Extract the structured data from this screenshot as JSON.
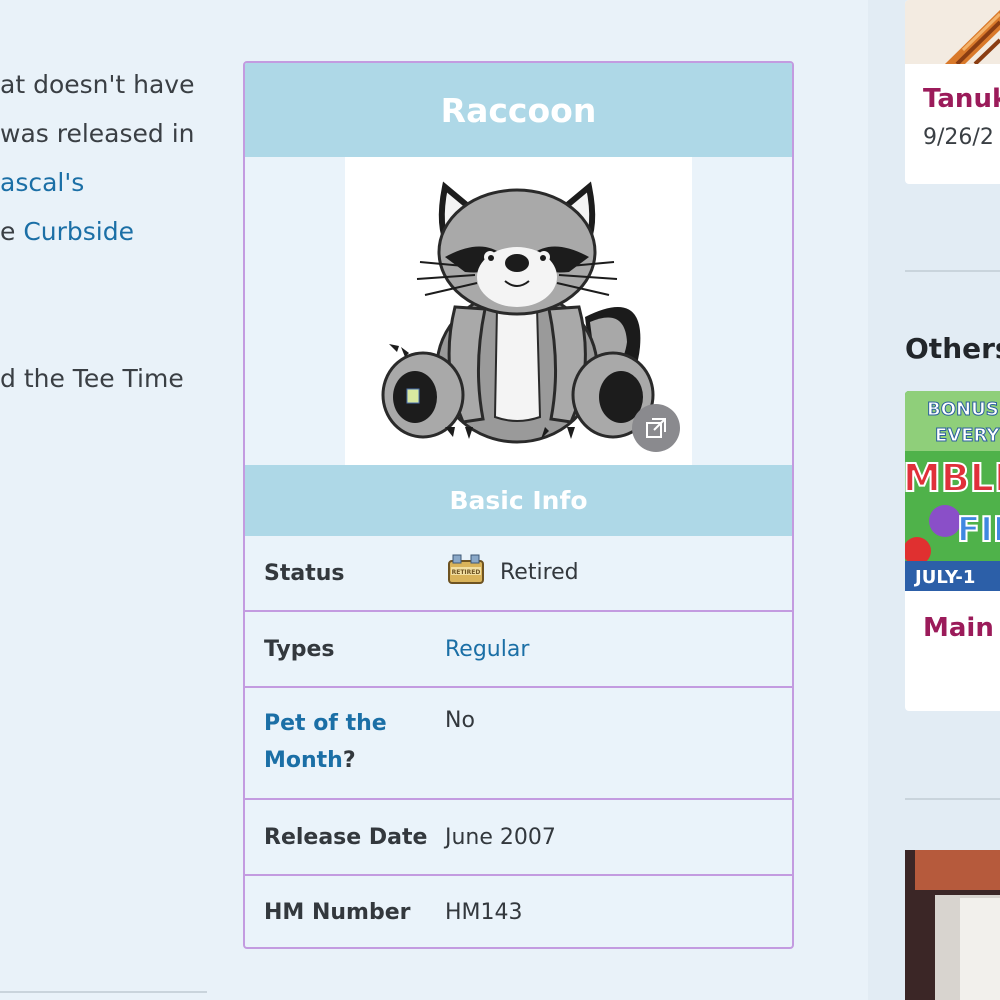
{
  "article": {
    "line1": "at doesn't have",
    "line2": "was released in",
    "line3_link": "ascal's",
    "line4_prefix": "e ",
    "line4_link": "Curbside",
    "line5": "d the Tee Time"
  },
  "infobox": {
    "title": "Raccoon",
    "section_title": "Basic Info",
    "rows": [
      {
        "label": "Status",
        "value": "Retired"
      },
      {
        "label": "Types",
        "value": "Regular"
      },
      {
        "label_link_1": "Pet of the",
        "label_link_2": "Month",
        "label_suffix": "?",
        "value": "No"
      },
      {
        "label": "Release Date",
        "value": "June 2007"
      },
      {
        "label": "HM Number",
        "value": "HM143"
      }
    ],
    "badge_text": "RETIRED"
  },
  "sidebar": {
    "card1": {
      "title": "Tanuk",
      "date": "9/26/2"
    },
    "heading": "Others",
    "card2": {
      "title": "Main I",
      "banner_top": "BONUS",
      "banner_mid": "EVERY",
      "banner_word": "MBLE",
      "banner_word2": "FIE",
      "banner_bottom": "JULY-1"
    }
  },
  "colors": {
    "header_bg": "#aed8e7",
    "border": "#c39be0",
    "link": "#1b6fa6",
    "sidebar_title": "#9b1b5a",
    "page_bg": "#e9f2f9"
  },
  "icons": {
    "expand": "expand-icon",
    "badge": "retired-badge-icon"
  }
}
